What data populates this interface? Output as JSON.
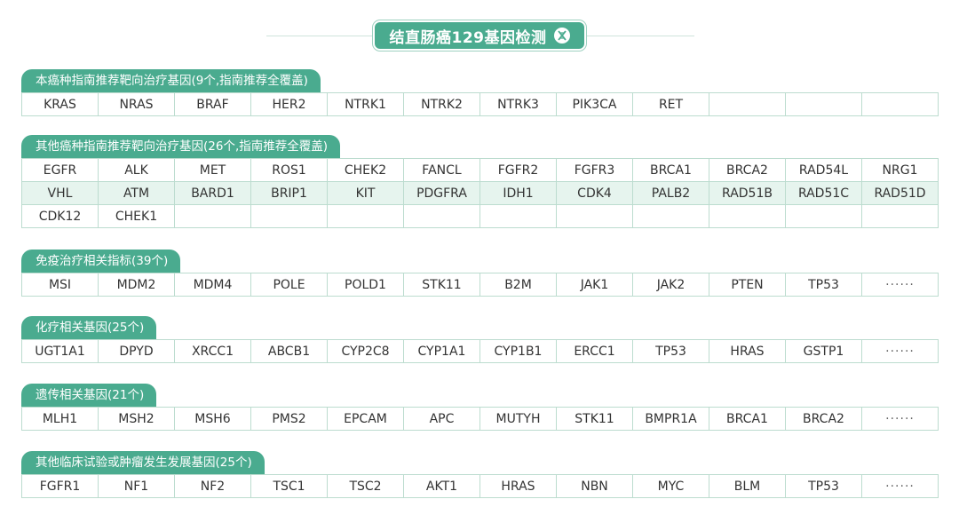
{
  "title": "结直肠癌129基因检测",
  "sections": [
    {
      "label": "本癌种指南推荐靶向治疗基因(9个,指南推荐全覆盖)",
      "rows": [
        [
          "KRAS",
          "NRAS",
          "BRAF",
          "HER2",
          "NTRK1",
          "NTRK2",
          "NTRK3",
          "PIK3CA",
          "RET",
          "",
          "",
          ""
        ]
      ]
    },
    {
      "label": "其他癌种指南推荐靶向治疗基因(26个,指南推荐全覆盖)",
      "rows": [
        [
          "EGFR",
          "ALK",
          "MET",
          "ROS1",
          "CHEK2",
          "FANCL",
          "FGFR2",
          "FGFR3",
          "BRCA1",
          "BRCA2",
          "RAD54L",
          "NRG1"
        ],
        [
          "VHL",
          "ATM",
          "BARD1",
          "BRIP1",
          "KIT",
          "PDGFRA",
          "IDH1",
          "CDK4",
          "PALB2",
          "RAD51B",
          "RAD51C",
          "RAD51D"
        ],
        [
          "CDK12",
          "CHEK1",
          "",
          "",
          "",
          "",
          "",
          "",
          "",
          "",
          "",
          ""
        ]
      ]
    },
    {
      "label": "免疫治疗相关指标(39个)",
      "rows": [
        [
          "MSI",
          "MDM2",
          "MDM4",
          "POLE",
          "POLD1",
          "STK11",
          "B2M",
          "JAK1",
          "JAK2",
          "PTEN",
          "TP53",
          "······"
        ]
      ]
    },
    {
      "label": "化疗相关基因(25个)",
      "rows": [
        [
          "UGT1A1",
          "DPYD",
          "XRCC1",
          "ABCB1",
          "CYP2C8",
          "CYP1A1",
          "CYP1B1",
          "ERCC1",
          "TP53",
          "HRAS",
          "GSTP1",
          "······"
        ]
      ]
    },
    {
      "label": "遗传相关基因(21个)",
      "rows": [
        [
          "MLH1",
          "MSH2",
          "MSH6",
          "PMS2",
          "EPCAM",
          "APC",
          "MUTYH",
          "STK11",
          "BMPR1A",
          "BRCA1",
          "BRCA2",
          "······"
        ]
      ]
    },
    {
      "label": "其他临床试验或肿瘤发生发展基因(25个)",
      "rows": [
        [
          "FGFR1",
          "NF1",
          "NF2",
          "TSC1",
          "TSC2",
          "AKT1",
          "HRAS",
          "NBN",
          "MYC",
          "BLM",
          "TP53",
          "······"
        ]
      ]
    }
  ],
  "colors": {
    "accent": "#4aab8f",
    "border": "#bcdccf",
    "row_alt": "#e6f4ee",
    "text": "#333333"
  }
}
